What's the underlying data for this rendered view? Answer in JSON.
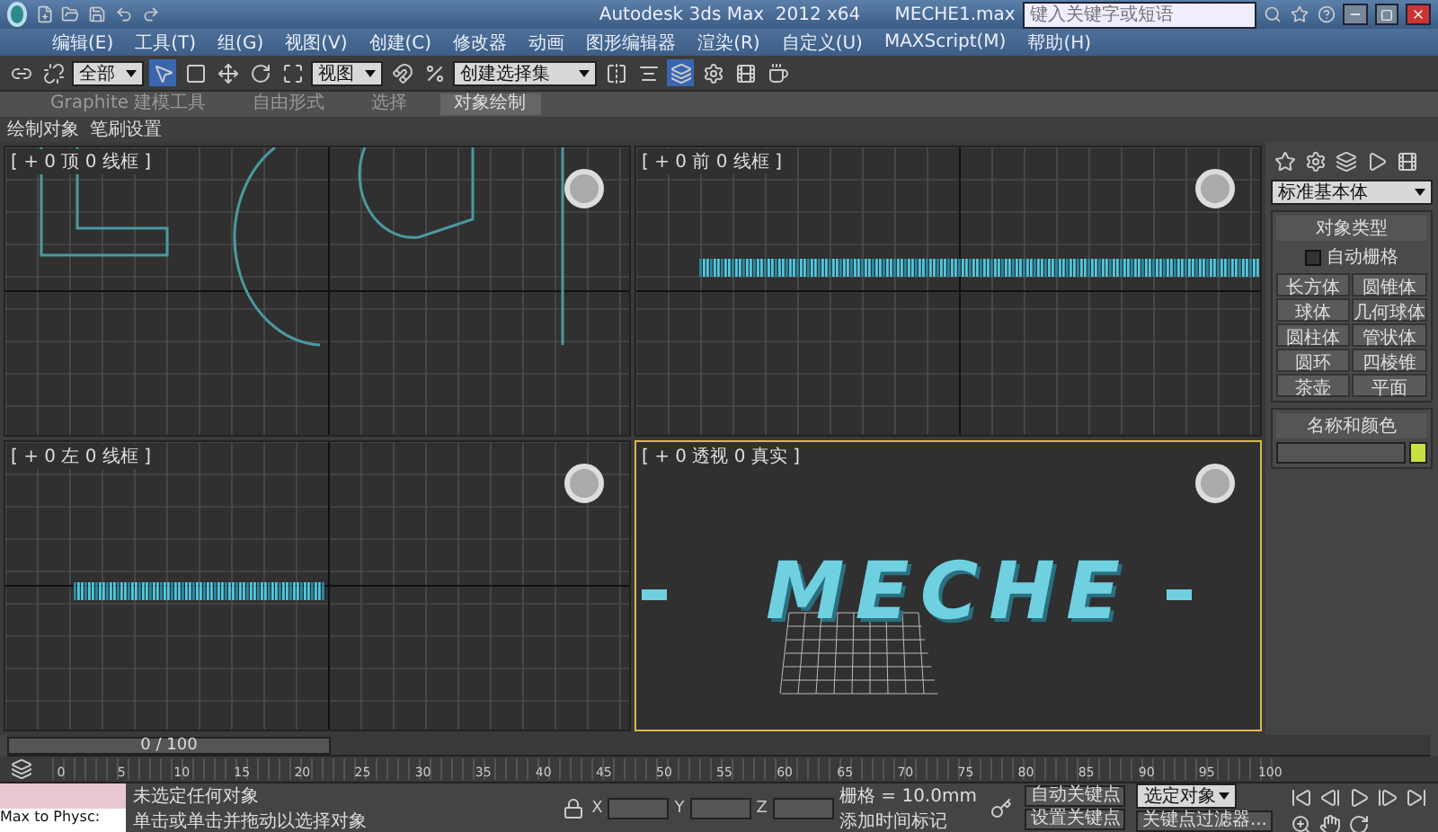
{
  "title_bar": {
    "title": "Autodesk 3ds Max  2012 x64      MECHE1.max",
    "search": {
      "placeholder": "键入关键字或短语"
    }
  },
  "menu_bar": [
    "编辑(E)",
    "工具(T)",
    "组(G)",
    "视图(V)",
    "创建(C)",
    "修改器",
    "动画",
    "图形编辑器",
    "渲染(R)",
    "自定义(U)",
    "MAXScript(M)",
    "帮助(H)"
  ],
  "toolbar": {
    "selection_filter": "全部",
    "coordinate_system": "视图",
    "named_selection": "创建选择集"
  },
  "ribbon": {
    "tabs": [
      {
        "label": "Graphite 建模工具",
        "selected": false
      },
      {
        "label": "自由形式",
        "selected": false
      },
      {
        "label": "选择",
        "selected": false
      },
      {
        "label": "对象绘制",
        "selected": true
      }
    ],
    "panels": [
      "绘制对象",
      "笔刷设置"
    ]
  },
  "viewports": [
    {
      "label": "[ + 0 顶 0 线框 ]",
      "kind": "top",
      "active": false
    },
    {
      "label": "[ + 0 前 0 线框 ]",
      "kind": "front",
      "active": false
    },
    {
      "label": "[ + 0 左 0 线框 ]",
      "kind": "left",
      "active": false
    },
    {
      "label": "[ + 0 透视 0 真实 ]",
      "kind": "perspective",
      "active": true,
      "text": "MECHE"
    }
  ],
  "command_panel": {
    "dropdown": "标准基本体",
    "rollouts": [
      {
        "title": "对象类型",
        "checkbox": {
          "label": "自动栅格",
          "checked": false
        },
        "buttons": [
          "长方体",
          "圆锥体",
          "球体",
          "几何球体",
          "圆柱体",
          "管状体",
          "圆环",
          "四棱锥",
          "茶壶",
          "平面"
        ]
      },
      {
        "title": "名称和颜色"
      }
    ]
  },
  "timeline": {
    "frame": "0 / 100",
    "level": 0,
    "ticks": [
      "0",
      "5",
      "10",
      "15",
      "20",
      "25",
      "30",
      "35",
      "40",
      "45",
      "50",
      "55",
      "60",
      "65",
      "70",
      "75",
      "80",
      "85",
      "90",
      "95",
      "100"
    ]
  },
  "status": {
    "listener": "Max to Physc:",
    "messages": [
      "未选定任何对象",
      "单击或单击并拖动以选择对象"
    ],
    "axes": [
      "X",
      "Y",
      "Z"
    ],
    "grid": "栅格 = 10.0mm",
    "add_time_tag": "添加时间标记",
    "auto_key": "自动关键点",
    "auto_key_target": "选定对象",
    "set_key": "设置关键点",
    "key_filters": "关键点过滤器..."
  }
}
